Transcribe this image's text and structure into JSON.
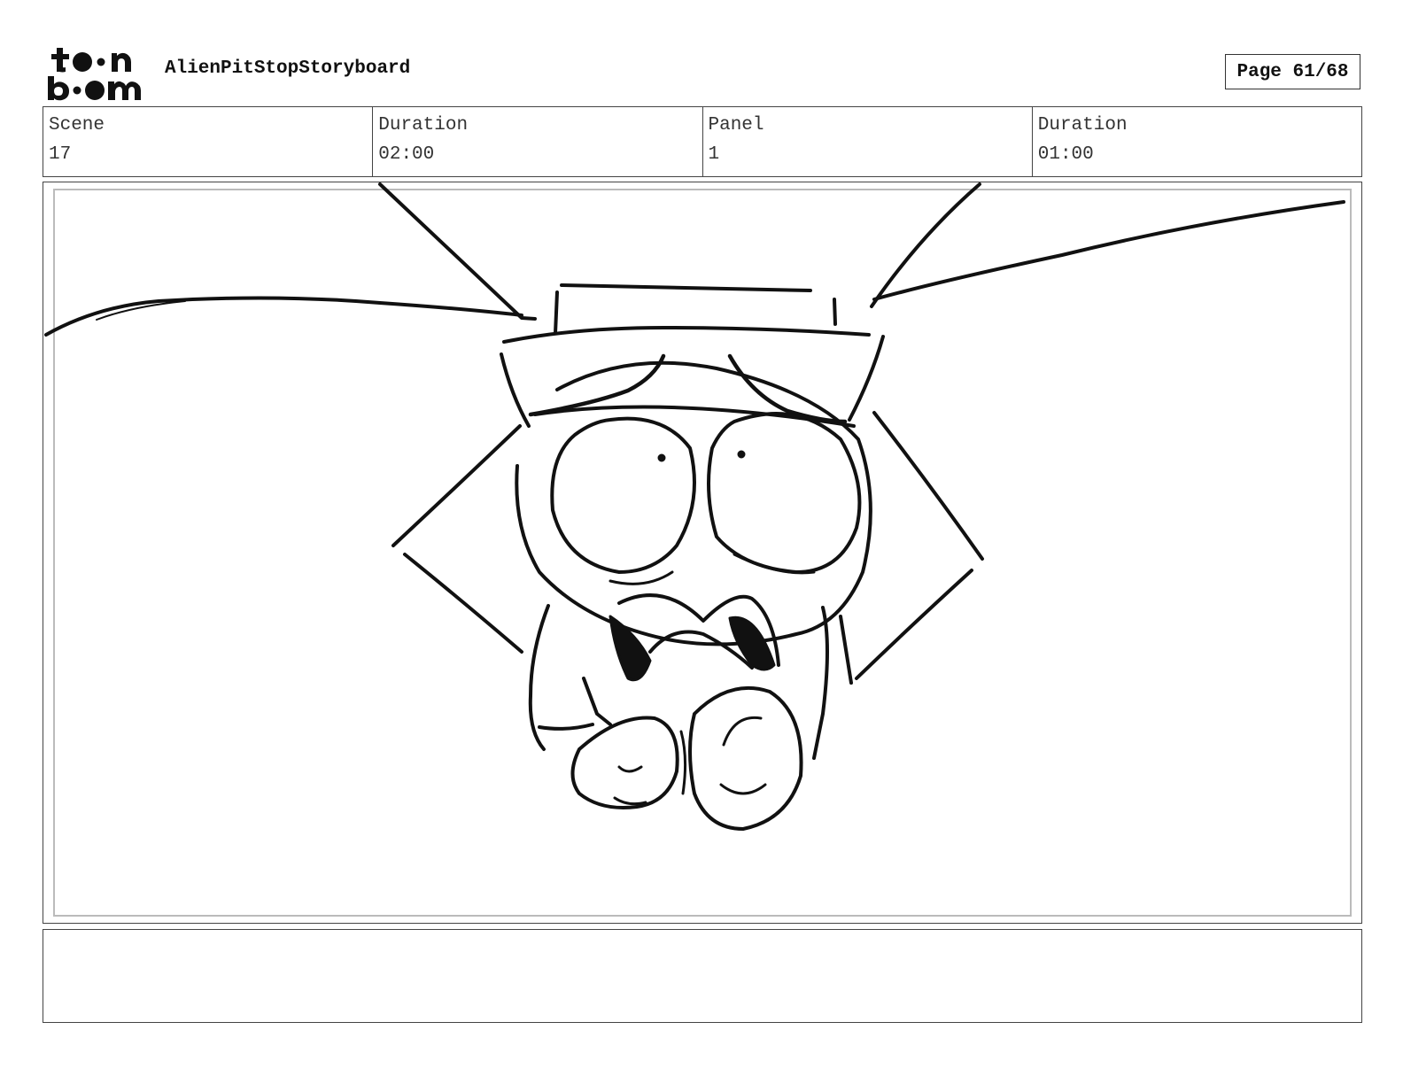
{
  "header": {
    "logo_alt": "toon boom",
    "title": "AlienPitStopStoryboard",
    "page_label": "Page 61/68"
  },
  "info": [
    {
      "label": "Scene",
      "value": "17"
    },
    {
      "label": "Duration",
      "value": "02:00"
    },
    {
      "label": "Panel",
      "value": "1"
    },
    {
      "label": "Duration",
      "value": "01:00"
    }
  ],
  "notes": ""
}
